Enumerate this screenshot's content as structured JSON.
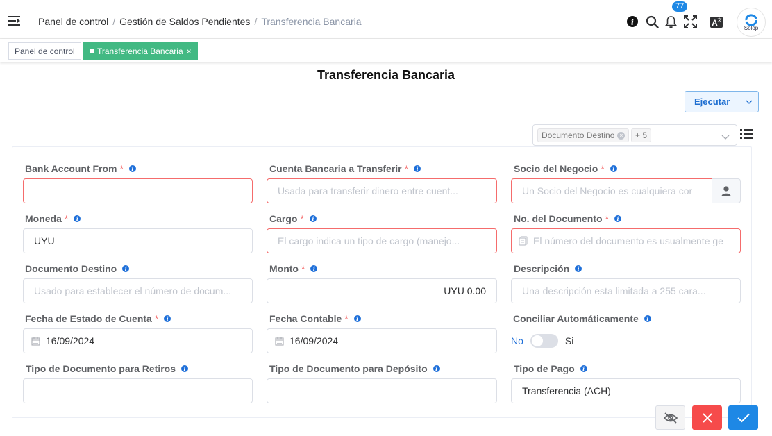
{
  "header": {
    "breadcrumbs": [
      "Panel de control",
      "Gestión de Saldos Pendientes",
      "Transferencia Bancaria"
    ],
    "notification_count": "77",
    "avatar_brand": "Solop"
  },
  "tags": {
    "dashboard": "Panel de control",
    "active": "Transferencia Bancaria",
    "close": "×"
  },
  "page": {
    "title": "Transferencia Bancaria",
    "execute_label": "Ejecutar"
  },
  "field_selector": {
    "chip": "Documento Destino",
    "more": "+ 5"
  },
  "fields": {
    "bank_account_from": {
      "label": "Bank Account From",
      "required": "*",
      "placeholder": ""
    },
    "cuenta_transferir": {
      "label": "Cuenta Bancaria a Transferir",
      "required": "*",
      "placeholder": "Usada para transferir dinero entre cuent..."
    },
    "socio_negocio": {
      "label": "Socio del Negocio",
      "required": "*",
      "placeholder": "Un Socio del Negocio es cualquiera cor"
    },
    "moneda": {
      "label": "Moneda",
      "required": "*",
      "value": "UYU"
    },
    "cargo": {
      "label": "Cargo",
      "required": "*",
      "placeholder": "El cargo indica un tipo de cargo (manejo..."
    },
    "no_documento": {
      "label": "No. del Documento",
      "required": "*",
      "placeholder": "El número del documento es usualmente ge"
    },
    "documento_destino": {
      "label": "Documento Destino",
      "placeholder": "Usado para establecer el número de docum..."
    },
    "monto": {
      "label": "Monto",
      "required": "*",
      "value": "UYU 0.00"
    },
    "descripcion": {
      "label": "Descripción",
      "placeholder": "Una descripción esta limitada a 255 cara..."
    },
    "fecha_estado": {
      "label": "Fecha de Estado de Cuenta",
      "required": "*",
      "value": "16/09/2024"
    },
    "fecha_contable": {
      "label": "Fecha Contable",
      "required": "*",
      "value": "16/09/2024"
    },
    "conciliar": {
      "label": "Conciliar Automáticamente",
      "off_label": "No",
      "on_label": "Si",
      "checked": false
    },
    "tipo_doc_retiros": {
      "label": "Tipo de Documento para Retiros",
      "value": ""
    },
    "tipo_doc_deposito": {
      "label": "Tipo de Documento para Depósito",
      "value": ""
    },
    "tipo_pago": {
      "label": "Tipo de Pago",
      "value": "Transferencia (ACH)"
    }
  },
  "colors": {
    "accent": "#1e6fd9",
    "tag_active": "#42b983",
    "error": "#f56c6c",
    "cancel": "#f64b4b",
    "confirm": "#1e88e5"
  }
}
